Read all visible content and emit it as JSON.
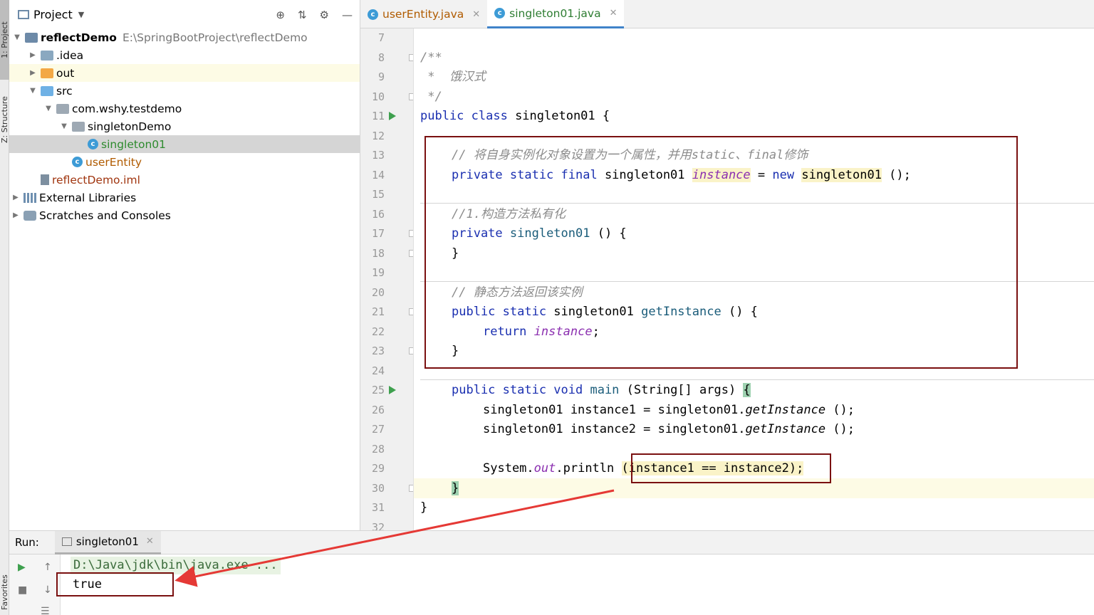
{
  "left_strip": {
    "project": "1: Project",
    "structure": "Z: Structure",
    "favorites": "Favorites"
  },
  "project_panel": {
    "title": "Project",
    "tree": [
      {
        "label": "reflectDemo",
        "path": "E:\\SpringBootProject\\reflectDemo"
      },
      {
        "label": ".idea"
      },
      {
        "label": "out"
      },
      {
        "label": "src"
      },
      {
        "label": "com.wshy.testdemo"
      },
      {
        "label": "singletonDemo"
      },
      {
        "label": "singleton01"
      },
      {
        "label": "userEntity"
      },
      {
        "label": "reflectDemo.iml"
      },
      {
        "label": "External Libraries"
      },
      {
        "label": "Scratches and Consoles"
      }
    ]
  },
  "editor": {
    "tabs": [
      {
        "label": "userEntity.java"
      },
      {
        "label": "singleton01.java"
      }
    ],
    "line_numbers": [
      "7",
      "8",
      "9",
      "10",
      "11",
      "12",
      "13",
      "14",
      "15",
      "16",
      "17",
      "18",
      "19",
      "20",
      "21",
      "22",
      "23",
      "24",
      "25",
      "26",
      "27",
      "28",
      "29",
      "30",
      "31",
      "32"
    ],
    "code": {
      "l8": "/**",
      "l9": " *  饿汉式",
      "l10": " */",
      "l11_kw": "public class",
      "l11_name": " singleton01 ",
      "l11_brace": "{",
      "l13": "// 将自身实例化对象设置为一个属性，并用static、final修饰",
      "l14_kw": "private static final",
      "l14_type": " singleton01 ",
      "l14_field": "instance",
      "l14_eq": " = ",
      "l14_new": "new",
      "l14_ctor": "singleton01",
      "l14_end": " ();",
      "l16": "//1.构造方法私有化",
      "l17_kw": "private",
      "l17_name": " singleton01",
      "l17_end": " () {",
      "l18": "}",
      "l20": "// 静态方法返回该实例",
      "l21_kw": "public static",
      "l21_type": " singleton01 ",
      "l21_name": "getInstance",
      "l21_end": " () {",
      "l22_kw": "return",
      "l22_field": "instance",
      "l22_end": ";",
      "l23": "}",
      "l25_kw": "public static void",
      "l25_name": " main ",
      "l25_args": "(String[] args) ",
      "l25_brace": "{",
      "l26_a": "singleton01 instance1 = singleton01.",
      "l26_m": "getInstance",
      "l26_b": " ();",
      "l27_a": "singleton01 instance2 = singleton01.",
      "l27_m": "getInstance",
      "l27_b": " ();",
      "l29_a": "System.",
      "l29_out": "out",
      "l29_b": ".println ",
      "l29_c": "(instance1 == instance2);",
      "l30": "}",
      "l31": "}"
    }
  },
  "run_panel": {
    "label": "Run:",
    "tab": "singleton01",
    "command": "D:\\Java\\jdk\\bin\\java.exe ...",
    "output": "true"
  },
  "colors": {
    "annotation_box": "#7a1010",
    "annotation_arrow": "#e53935",
    "run_green": "#3ea04e"
  }
}
